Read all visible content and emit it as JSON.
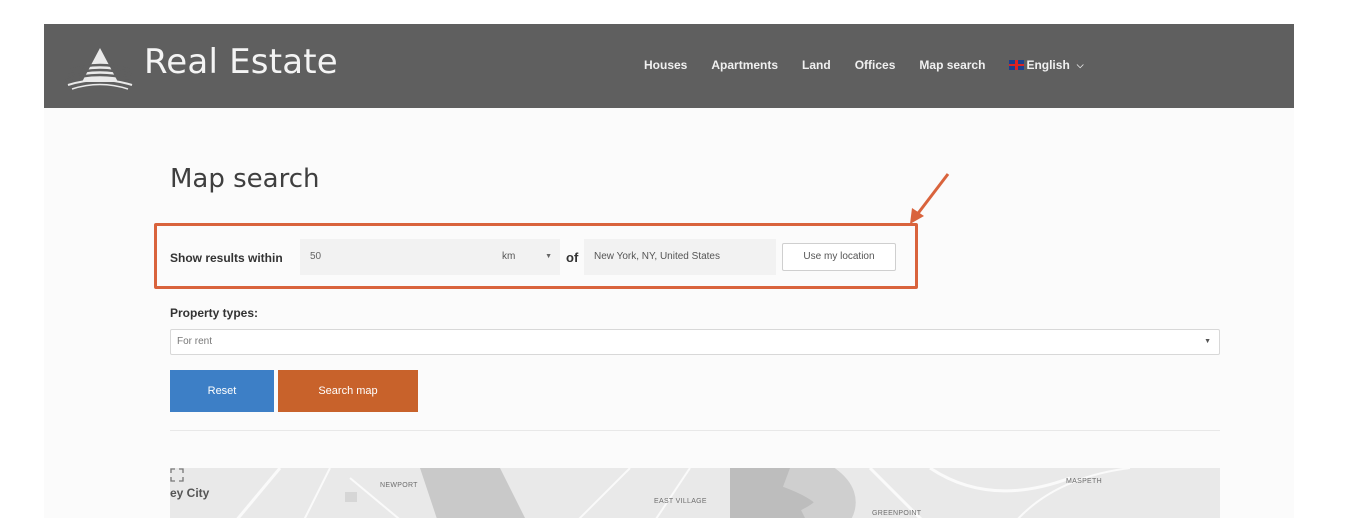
{
  "header": {
    "brand": "Real Estate",
    "nav_items": [
      "Houses",
      "Apartments",
      "Land",
      "Offices",
      "Map search"
    ],
    "language": "English",
    "logo_icon": "building-logo-icon",
    "language_flag_icon": "uk-flag-icon",
    "language_caret_icon": "chevron-down-icon"
  },
  "main": {
    "title": "Map search",
    "search": {
      "radius_label": "Show results within",
      "radius_value": "50",
      "unit": "km",
      "of_label": "of",
      "location": "New York, NY, United States",
      "use_location_label": "Use my location"
    },
    "property_types": {
      "label": "Property types:",
      "selected": "For rent"
    },
    "buttons": {
      "reset": "Reset",
      "search_map": "Search map"
    },
    "map": {
      "city_label": "ey City",
      "labels": [
        "NEWPORT",
        "EAST VILLAGE",
        "MASPETH",
        "GREENPOINT"
      ],
      "fullscreen_icon": "fullscreen-icon"
    }
  },
  "colors": {
    "header_bg": "#5f5f5f",
    "reset_button": "#3d7fc6",
    "search_button": "#c8622b",
    "annotation": "#d9633c"
  }
}
